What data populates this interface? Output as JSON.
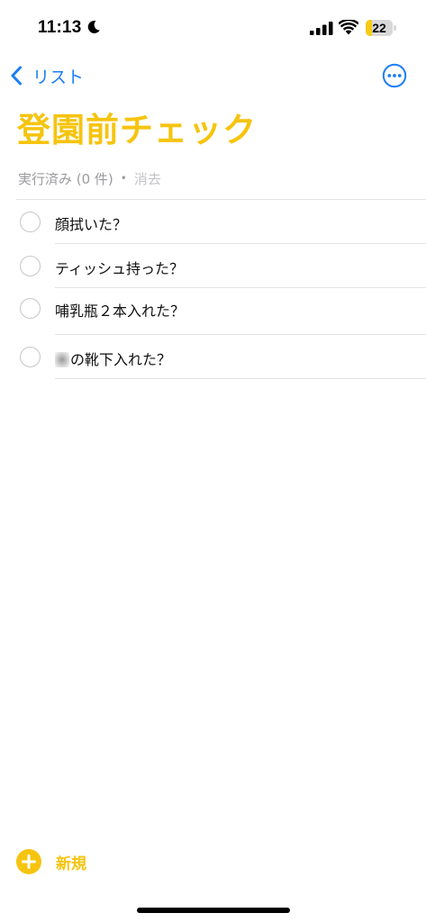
{
  "status_bar": {
    "time": "11:13",
    "battery_level": "22",
    "battery_fraction": 0.22,
    "icons": [
      "moon-icon",
      "signal-icon",
      "wifi-icon",
      "battery-icon"
    ]
  },
  "nav": {
    "back_label": "リスト",
    "back_icon": "chevron-left-icon",
    "more_icon": "ellipsis-circle-icon"
  },
  "list": {
    "title": "登園前チェック",
    "accent_color": "#f6c40f",
    "link_color": "#1b7ef5",
    "completed_label": "実行済み (0 件)",
    "separator": "•",
    "clear_label": "消去"
  },
  "tasks": [
    {
      "label": "顔拭いた？",
      "completed": false
    },
    {
      "label": "ティッシュ持った？",
      "completed": false
    },
    {
      "label": "哺乳瓶２本入れた？",
      "completed": false
    },
    {
      "label": "の靴下入れた？",
      "completed": false,
      "prefix_redacted": true
    }
  ],
  "footer": {
    "new_label": "新規",
    "new_icon": "plus-circle-icon"
  }
}
